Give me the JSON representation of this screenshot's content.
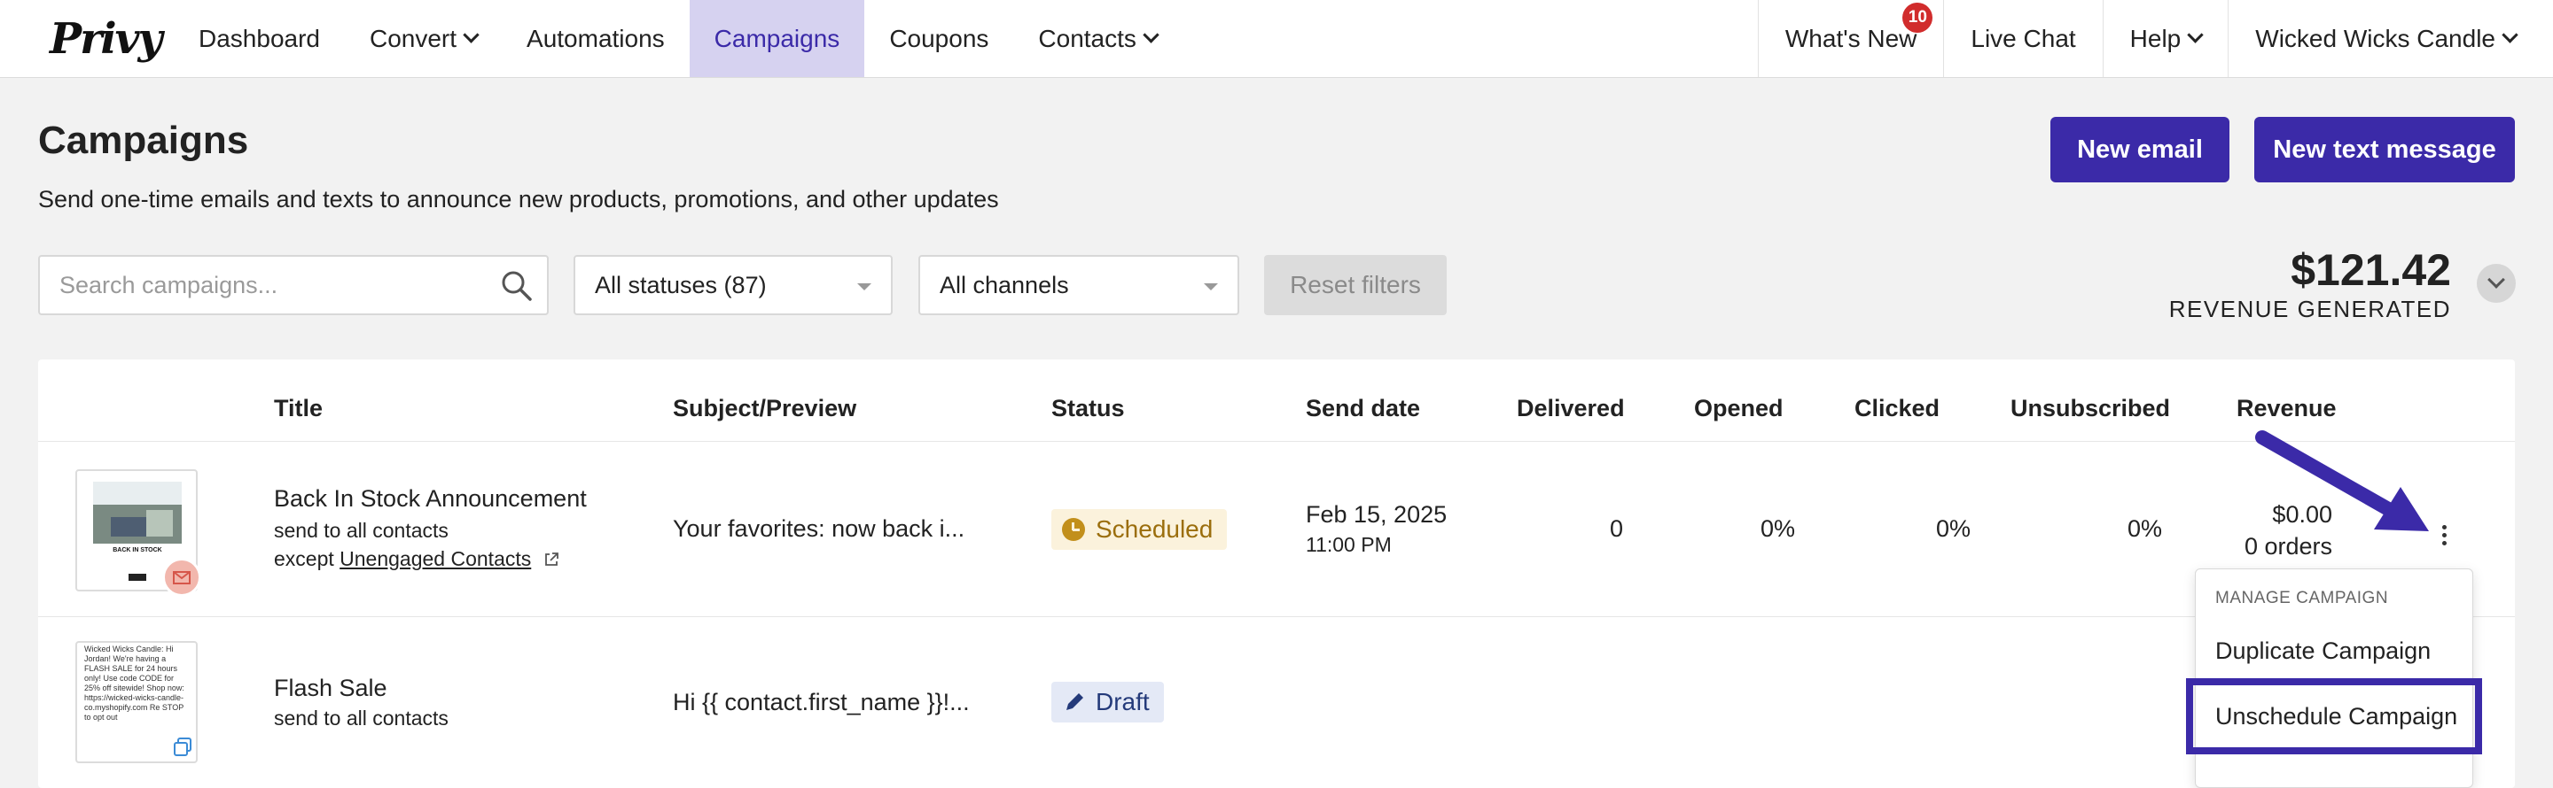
{
  "nav": {
    "logo": "Privy",
    "items": [
      "Dashboard",
      "Convert",
      "Automations",
      "Campaigns",
      "Coupons",
      "Contacts"
    ],
    "right": {
      "whats_new": "What's New",
      "whats_new_badge": "10",
      "live_chat": "Live Chat",
      "help": "Help",
      "account": "Wicked Wicks Candle"
    }
  },
  "header": {
    "title": "Campaigns",
    "subtitle": "Send one-time emails and texts to announce new products, promotions, and other updates",
    "new_email": "New email",
    "new_text": "New text message"
  },
  "filters": {
    "search_placeholder": "Search campaigns...",
    "status": "All statuses (87)",
    "channel": "All channels",
    "reset": "Reset filters"
  },
  "revenue": {
    "amount": "$121.42",
    "label": "REVENUE GENERATED"
  },
  "table": {
    "columns": [
      "Title",
      "Subject/Preview",
      "Status",
      "Send date",
      "Delivered",
      "Opened",
      "Clicked",
      "Unsubscribed",
      "Revenue"
    ],
    "rows": [
      {
        "title": "Back In Stock Announcement",
        "send_to_prefix": "send to",
        "send_to": "all contacts",
        "except_prefix": "except",
        "except": "Unengaged Contacts",
        "preview": "Your favorites: now back i...",
        "status": "Scheduled",
        "send_date": "Feb 15, 2025",
        "send_time": "11:00 PM",
        "delivered": "0",
        "opened": "0%",
        "clicked": "0%",
        "unsubscribed": "0%",
        "revenue": "$0.00",
        "orders": "0 orders",
        "thumb_text": "BACK IN STOCK"
      },
      {
        "title": "Flash Sale",
        "send_to_prefix": "send to",
        "send_to": "all contacts",
        "preview": "Hi {{ contact.first_name }}!...",
        "status": "Draft",
        "thumb_text": "Wicked Wicks Candle: Hi Jordan! We're having a FLASH SALE for 24 hours only! Use code CODE for 25% off sitewide! Shop now: https://wicked-wicks-candle-co.myshopify.com Re STOP to opt out"
      }
    ]
  },
  "menu": {
    "header": "MANAGE CAMPAIGN",
    "items": [
      "Duplicate Campaign",
      "Unschedule Campaign"
    ]
  },
  "colors": {
    "brand": "#3b2aa8",
    "active_nav": "#d6d2f0",
    "scheduled": "#9b6e0d",
    "draft": "#243a7a"
  }
}
